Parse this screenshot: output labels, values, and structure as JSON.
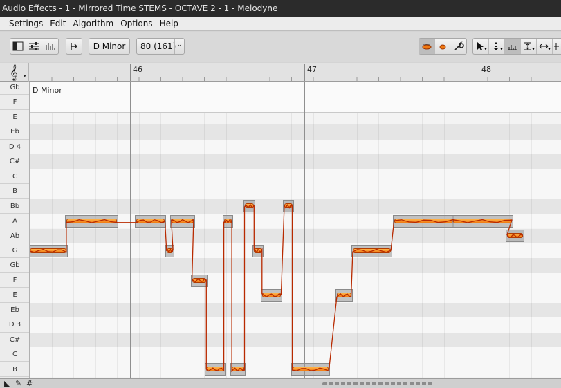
{
  "window": {
    "title": "Audio Effects - 1 - Mirrored Time STEMS - OCTAVE  2 - 1 - Melodyne"
  },
  "menu": [
    "Settings",
    "Edit",
    "Algorithm",
    "Options",
    "Help"
  ],
  "toolbar": {
    "scale_button": "D Minor",
    "tempo_button": "80 (161)",
    "tempo_caret": "⌄"
  },
  "ruler": {
    "bars": [
      "46",
      "47",
      "48"
    ],
    "clef": "𝄞"
  },
  "scale": {
    "label": "D Minor"
  },
  "pitch_rows": [
    "Gb",
    "F",
    "E",
    "Eb",
    "D 4",
    "C#",
    "C",
    "B",
    "Bb",
    "A",
    "Ab",
    "G",
    "Gb",
    "F",
    "E",
    "Eb",
    "D 3",
    "C#",
    "C",
    "B"
  ],
  "notes": [
    {
      "pitch": "G",
      "start": 0,
      "len": 0.23
    },
    {
      "pitch": "A",
      "start": 0.23,
      "len": 0.32
    },
    {
      "pitch": "A",
      "start": 0.67,
      "len": 0.18
    },
    {
      "pitch": "G",
      "start": 0.86,
      "len": 0.04
    },
    {
      "pitch": "A",
      "start": 0.89,
      "len": 0.14
    },
    {
      "pitch": "F",
      "start": 1.02,
      "len": 0.09
    },
    {
      "pitch": "B",
      "start": 1.11,
      "len": 0.11
    },
    {
      "pitch": "A",
      "start": 1.22,
      "len": 0.05
    },
    {
      "pitch": "B",
      "start": 1.27,
      "len": 0.08
    },
    {
      "pitch": "Bb",
      "start": 1.35,
      "len": 0.06
    },
    {
      "pitch": "G",
      "start": 1.41,
      "len": 0.05
    },
    {
      "pitch": "E",
      "start": 1.46,
      "len": 0.12
    },
    {
      "pitch": "Bb",
      "start": 1.6,
      "len": 0.05
    },
    {
      "pitch": "B",
      "start": 1.65,
      "len": 0.23
    },
    {
      "pitch": "E",
      "start": 1.93,
      "len": 0.09
    },
    {
      "pitch": "G",
      "start": 2.03,
      "len": 0.24
    },
    {
      "pitch": "A",
      "start": 2.29,
      "len": 0.37
    },
    {
      "pitch": "A",
      "start": 2.66,
      "len": 0.37
    },
    {
      "pitch": "Ab",
      "start": 3.0,
      "len": 0.1
    }
  ]
}
